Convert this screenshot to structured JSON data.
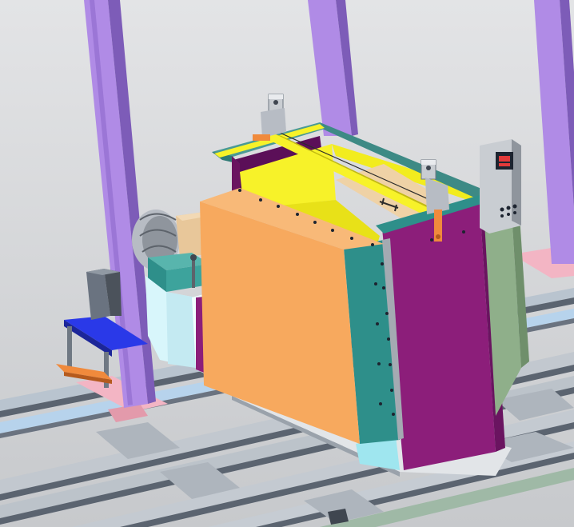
{
  "colors": {
    "background_top": "#e3e4e6",
    "background_bottom": "#c7c9cc",
    "purple_column": "#b08be6",
    "purple_column_dark": "#7d5cb8",
    "rail_gray": "#9aa3ad",
    "rail_dark": "#5b6470",
    "rail_blue": "#b7d3ec",
    "pink_pad": "#f3b5c4",
    "orange_panel": "#f7a95e",
    "teal": "#2e8f8a",
    "magenta": "#8c1e7a",
    "yellow": "#f7f229",
    "sage": "#8faf8a",
    "blue_plate": "#2a39e8",
    "orange_bar": "#f08a3c",
    "controller_gray": "#c9cdd2",
    "display_red": "#e23a3a",
    "light_cyan": "#d8f6fb",
    "wheel_gray": "#b7bcc4",
    "tan": "#e8c79a"
  },
  "icons": [
    "control-panel-icon",
    "temperature-display-icon",
    "lifting-hook-icon",
    "blower-fan-icon"
  ]
}
